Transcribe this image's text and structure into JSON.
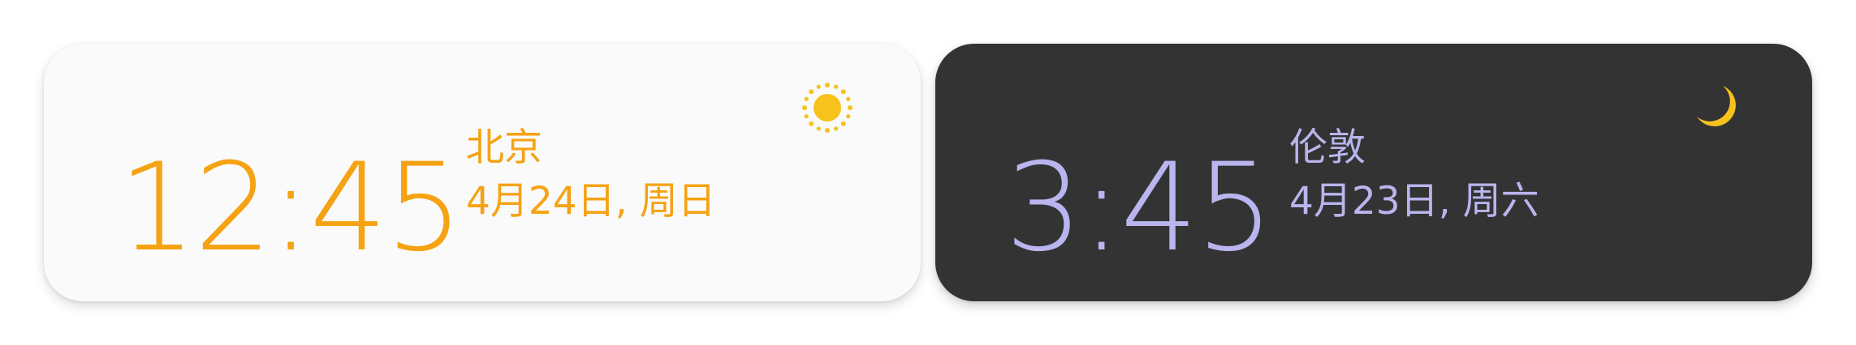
{
  "widgets": [
    {
      "theme": "light",
      "time": "12:45",
      "city": "北京",
      "date": "4月24日, 周日",
      "icon": "sun-icon",
      "accent_color": "#f5a313",
      "background_color": "#fafafa"
    },
    {
      "theme": "dark",
      "time": "3:45",
      "city": "伦敦",
      "date": "4月23日, 周六",
      "icon": "moon-icon",
      "accent_color": "#b9b5ee",
      "background_color": "#333333"
    }
  ],
  "colors": {
    "sun": "#f7c21c",
    "moon": "#f7c21c"
  }
}
